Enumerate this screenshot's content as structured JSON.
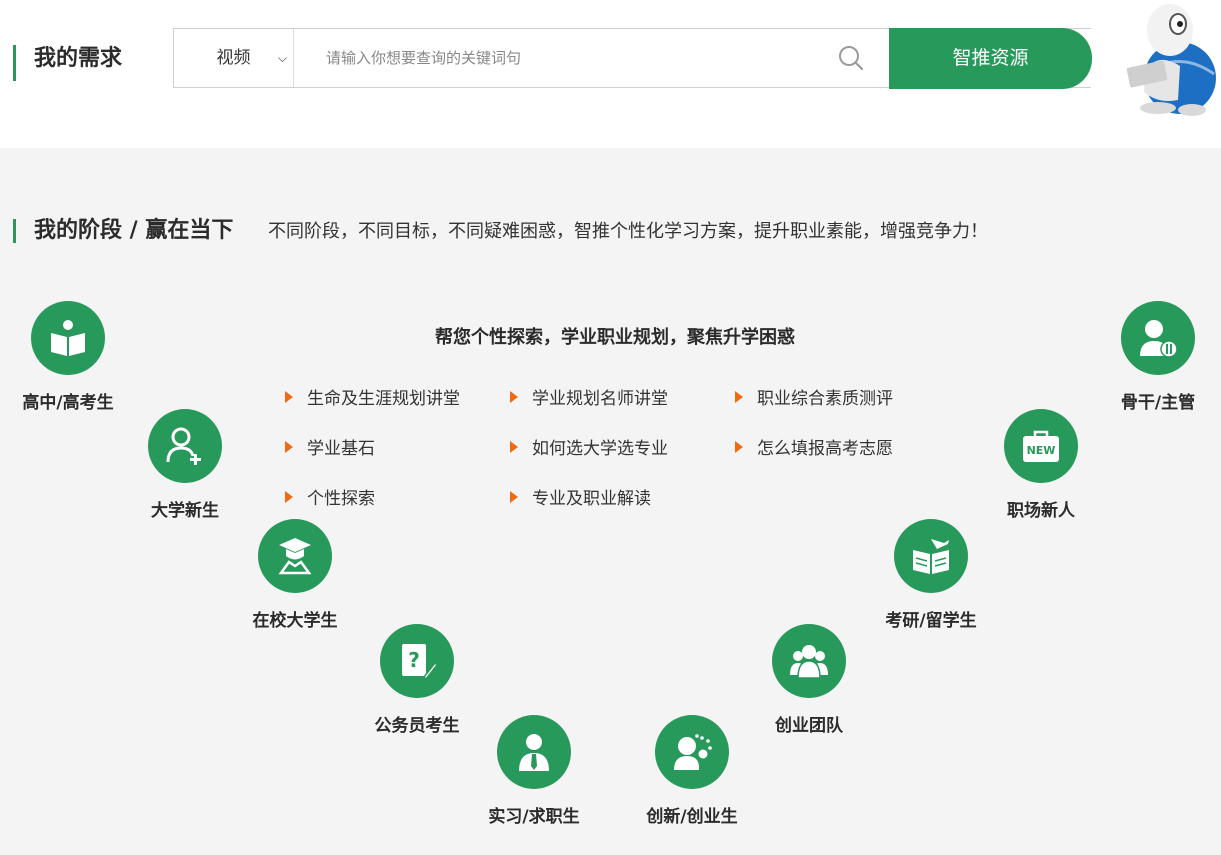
{
  "header": {
    "title": "我的需求",
    "select_value": "视频",
    "search_placeholder": "请输入你想要查询的关键词句",
    "search_button": "智推资源"
  },
  "section": {
    "title": "我的阶段 / 赢在当下",
    "subtitle": "不同阶段，不同目标，不同疑难困惑，智推个性化学习方案，提升职业素能，增强竞争力！"
  },
  "center": {
    "heading": "帮您个性探索，学业职业规划，聚焦升学困惑",
    "links": [
      "生命及生涯规划讲堂",
      "学业规划名师讲堂",
      "职业综合素质测评",
      "学业基石",
      "如何选大学选专业",
      "怎么填报高考志愿",
      "个性探索",
      "专业及职业解读"
    ]
  },
  "stages": [
    {
      "label": "高中/高考生",
      "icon": "open-book-icon"
    },
    {
      "label": "大学新生",
      "icon": "user-add-icon"
    },
    {
      "label": "在校大学生",
      "icon": "student-cap-icon"
    },
    {
      "label": "公务员考生",
      "icon": "question-edit-icon"
    },
    {
      "label": "实习/求职生",
      "icon": "person-tie-icon"
    },
    {
      "label": "创新/创业生",
      "icon": "idea-person-icon"
    },
    {
      "label": "创业团队",
      "icon": "team-icon"
    },
    {
      "label": "考研/留学生",
      "icon": "book-plane-icon"
    },
    {
      "label": "职场新人",
      "icon": "new-briefcase-icon"
    },
    {
      "label": "骨干/主管",
      "icon": "manager-icon"
    }
  ],
  "colors": {
    "accent": "#27995b",
    "arrow": "#f06a14",
    "background": "#f4f4f4"
  }
}
